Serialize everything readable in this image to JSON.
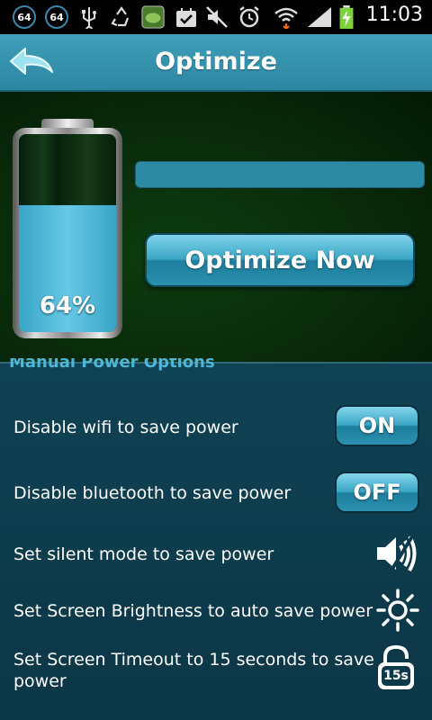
{
  "status_bar": {
    "badge_left": "64",
    "badge_right": "64",
    "time": "11:03",
    "icons": [
      "usb-icon",
      "recycle-icon",
      "app-icon",
      "check-icon",
      "mute-icon",
      "alarm-icon",
      "wifi-icon",
      "signal-icon",
      "battery-charging-icon"
    ]
  },
  "header": {
    "title": "Optimize",
    "back_icon": "back-arrow-icon"
  },
  "battery": {
    "level": 0.64,
    "label": "64%"
  },
  "progress": {
    "fraction": 0.0
  },
  "optimize_button": {
    "label": "Optimize Now"
  },
  "manual": {
    "section_title": "Manual Power Options",
    "options": [
      {
        "label": "Disable wifi to save power",
        "control": "ON"
      },
      {
        "label": "Disable bluetooth to save power",
        "control": "OFF"
      },
      {
        "label": "Set silent mode to save power",
        "icon": "speaker-icon"
      },
      {
        "label": "Set Screen Brightness to auto save power",
        "icon": "sun-icon"
      },
      {
        "label_line1": "Set Screen Timeout to 15 seconds to save",
        "label_line2": "power",
        "icon": "lock-timer-icon",
        "icon_text": "15s"
      }
    ]
  },
  "colors": {
    "accent": "#3aa6c5",
    "header": "#3f9fb9",
    "panel": "#08280a",
    "background": "#0c3a4a"
  }
}
